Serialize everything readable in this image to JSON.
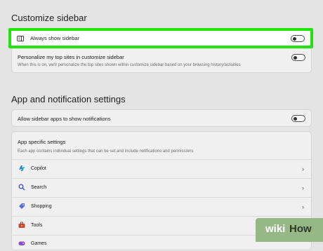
{
  "customize_sidebar": {
    "title": "Customize sidebar",
    "always_show": {
      "label": "Always show sidebar",
      "enabled": false
    },
    "personalize": {
      "label": "Personalize my top sites in customize sidebar",
      "description": "When this is on, we'll personalize the top sites shown within customize sidebar based on your browsing history/activities",
      "enabled": false
    }
  },
  "app_notifications": {
    "title": "App and notification settings",
    "allow_notifications": {
      "label": "Allow sidebar apps to show notifications",
      "enabled": false
    },
    "app_specific": {
      "title": "App specific settings",
      "description": "Each app contains individual settings that can be set and include notifications and permissions",
      "apps": [
        {
          "label": "Copilot",
          "icon": "copilot-icon"
        },
        {
          "label": "Search",
          "icon": "search-icon"
        },
        {
          "label": "Shopping",
          "icon": "shopping-tag-icon"
        },
        {
          "label": "Tools",
          "icon": "toolbox-icon"
        },
        {
          "label": "Games",
          "icon": "games-icon"
        }
      ]
    }
  },
  "watermark": {
    "part1": "wiki",
    "part2": "How"
  },
  "colors": {
    "highlight": "#21e40e",
    "watermark_bg": "#96b886"
  }
}
